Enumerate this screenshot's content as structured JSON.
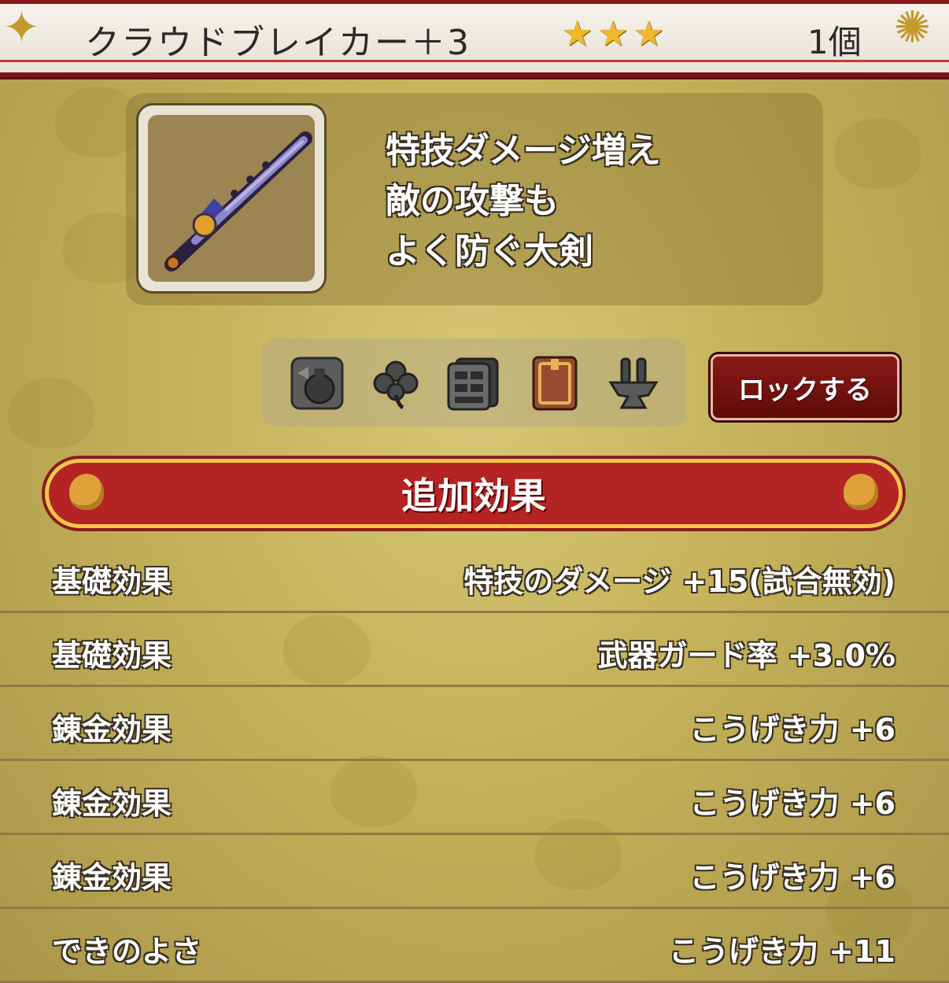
{
  "header": {
    "title": "クラウドブレイカー＋3",
    "stars": [
      "★",
      "★",
      "★"
    ],
    "count": "1個"
  },
  "item": {
    "description_lines": [
      "特技ダメージ増え",
      "敵の攻撃も",
      "よく防ぐ大剣"
    ]
  },
  "icons": [
    "bag-exchange-icon",
    "clover-icon",
    "storage-drawer-icon",
    "book-icon",
    "anvil-icon"
  ],
  "lock_button": "ロックする",
  "section_title": "追加効果",
  "effects": [
    {
      "label": "基礎効果",
      "value": "特技のダメージ +15(試合無効)"
    },
    {
      "label": "基礎効果",
      "value": "武器ガード率 +3.0%"
    },
    {
      "label": "錬金効果",
      "value": "こうげき力 +6"
    },
    {
      "label": "錬金効果",
      "value": "こうげき力 +6"
    },
    {
      "label": "錬金効果",
      "value": "こうげき力 +6"
    },
    {
      "label": "できのよさ",
      "value": "こうげき力 +11"
    }
  ],
  "colors": {
    "header_red": "#7d1414",
    "banner_red": "#b42424",
    "gold": "#c4b159",
    "star": "#f0b82a"
  }
}
